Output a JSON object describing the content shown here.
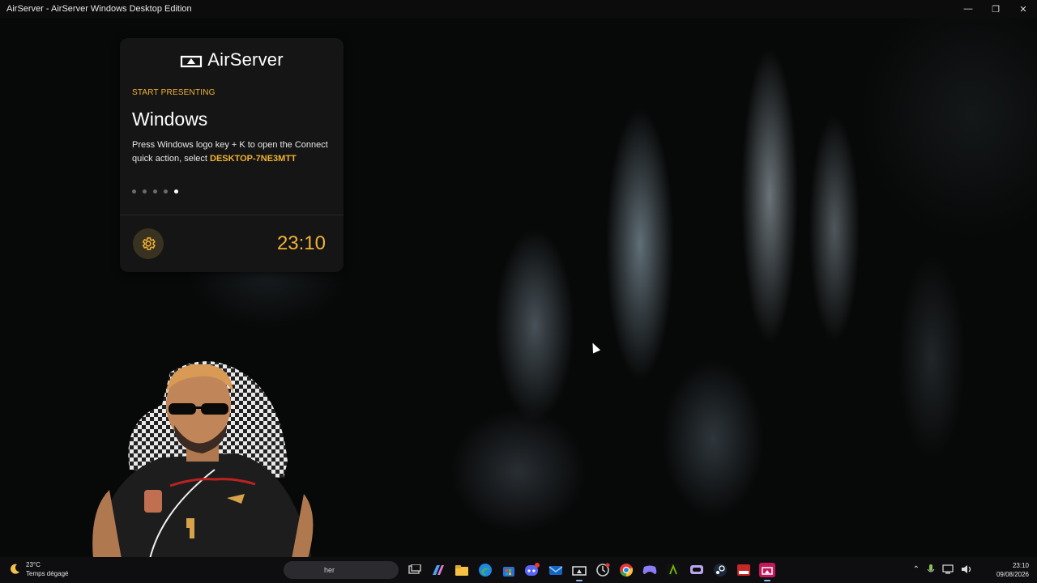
{
  "window": {
    "title": "AirServer - AirServer Windows Desktop Edition"
  },
  "card": {
    "logo_text": "AirServer",
    "kicker": "START PRESENTING",
    "heading": "Windows",
    "desc_prefix": "Press Windows logo key + K to open the Connect quick action, select ",
    "device_name": "DESKTOP-7NE3MTT",
    "carousel": {
      "total": 5,
      "active_index": 5
    },
    "clock": "23:10"
  },
  "taskbar": {
    "weather": {
      "temp": "23°C",
      "condition": "Temps dégagé"
    },
    "search_text": "her",
    "apps": [
      "task-view",
      "copilot",
      "file-explorer",
      "edge",
      "store",
      "discord",
      "mail",
      "airserver",
      "clock-app",
      "chrome",
      "gamepad",
      "nvidia",
      "app-monitor",
      "steam",
      "media-app",
      "airserver-active"
    ],
    "time": "23:10",
    "date": "09/08/2026"
  },
  "colors": {
    "accent": "#f2b233",
    "card_bg": "#151515",
    "taskbar_bg": "#0e0e10"
  }
}
